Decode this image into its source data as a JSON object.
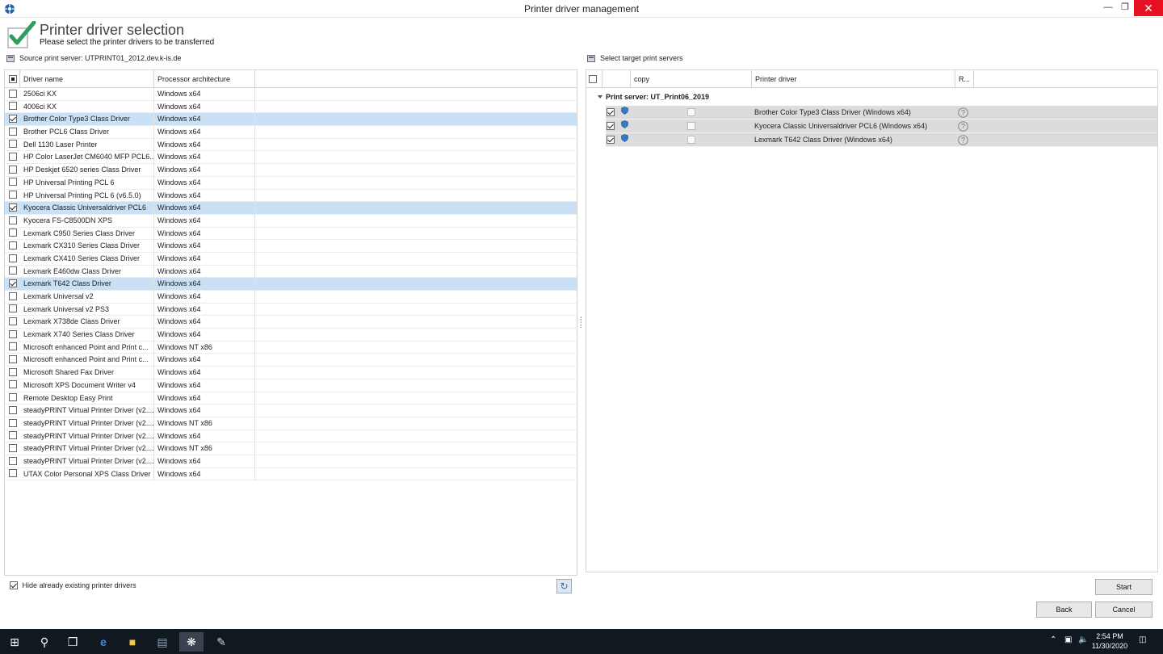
{
  "window": {
    "title": "Printer driver management"
  },
  "header": {
    "title": "Printer driver selection",
    "subtitle": "Please select the printer drivers to be transferred"
  },
  "source": {
    "label": "Source print server: UTPRINT01_2012.dev.k-is.de",
    "columns": [
      "Driver name",
      "Processor architecture"
    ],
    "rows": [
      {
        "name": "2506ci KX",
        "arch": "Windows x64",
        "checked": false
      },
      {
        "name": "4006ci KX",
        "arch": "Windows x64",
        "checked": false
      },
      {
        "name": "Brother Color Type3 Class Driver",
        "arch": "Windows x64",
        "checked": true
      },
      {
        "name": "Brother PCL6 Class Driver",
        "arch": "Windows x64",
        "checked": false
      },
      {
        "name": "Dell 1130 Laser Printer",
        "arch": "Windows x64",
        "checked": false
      },
      {
        "name": "HP Color LaserJet CM6040 MFP PCL6...",
        "arch": "Windows x64",
        "checked": false
      },
      {
        "name": "HP Deskjet 6520 series Class Driver",
        "arch": "Windows x64",
        "checked": false
      },
      {
        "name": "HP Universal Printing PCL 6",
        "arch": "Windows x64",
        "checked": false
      },
      {
        "name": "HP Universal Printing PCL 6 (v6.5.0)",
        "arch": "Windows x64",
        "checked": false
      },
      {
        "name": "Kyocera Classic Universaldriver PCL6",
        "arch": "Windows x64",
        "checked": true
      },
      {
        "name": "Kyocera FS-C8500DN XPS",
        "arch": "Windows x64",
        "checked": false
      },
      {
        "name": "Lexmark C950 Series Class Driver",
        "arch": "Windows x64",
        "checked": false
      },
      {
        "name": "Lexmark CX310 Series Class Driver",
        "arch": "Windows x64",
        "checked": false
      },
      {
        "name": "Lexmark CX410 Series Class Driver",
        "arch": "Windows x64",
        "checked": false
      },
      {
        "name": "Lexmark E460dw Class Driver",
        "arch": "Windows x64",
        "checked": false
      },
      {
        "name": "Lexmark T642 Class Driver",
        "arch": "Windows x64",
        "checked": true
      },
      {
        "name": "Lexmark Universal v2",
        "arch": "Windows x64",
        "checked": false
      },
      {
        "name": "Lexmark Universal v2 PS3",
        "arch": "Windows x64",
        "checked": false
      },
      {
        "name": "Lexmark X738de Class Driver",
        "arch": "Windows x64",
        "checked": false
      },
      {
        "name": "Lexmark X740 Series Class Driver",
        "arch": "Windows x64",
        "checked": false
      },
      {
        "name": "Microsoft enhanced Point and Print c...",
        "arch": "Windows NT x86",
        "checked": false
      },
      {
        "name": "Microsoft enhanced Point and Print c...",
        "arch": "Windows x64",
        "checked": false
      },
      {
        "name": "Microsoft Shared Fax Driver",
        "arch": "Windows x64",
        "checked": false
      },
      {
        "name": "Microsoft XPS Document Writer v4",
        "arch": "Windows x64",
        "checked": false
      },
      {
        "name": "Remote Desktop Easy Print",
        "arch": "Windows x64",
        "checked": false
      },
      {
        "name": "steadyPRINT Virtual Printer Driver (v2....",
        "arch": "Windows x64",
        "checked": false
      },
      {
        "name": "steadyPRINT Virtual Printer Driver (v2....",
        "arch": "Windows NT x86",
        "checked": false
      },
      {
        "name": "steadyPRINT Virtual Printer Driver (v2....",
        "arch": "Windows x64",
        "checked": false
      },
      {
        "name": "steadyPRINT Virtual Printer Driver (v2....",
        "arch": "Windows NT x86",
        "checked": false
      },
      {
        "name": "steadyPRINT Virtual Printer Driver (v2....",
        "arch": "Windows x64",
        "checked": false
      },
      {
        "name": "UTAX Color Personal XPS Class Driver",
        "arch": "Windows x64",
        "checked": false
      }
    ],
    "hide_existing_label": "Hide already existing printer drivers"
  },
  "target": {
    "label": "Select target print servers",
    "columns": {
      "copy": "copy",
      "driver": "Printer driver",
      "r": "R..."
    },
    "group": "Print server: UT_Print06_2019",
    "rows": [
      {
        "driver": "Brother Color Type3 Class Driver (Windows x64)"
      },
      {
        "driver": "Kyocera Classic Universaldriver PCL6 (Windows x64)"
      },
      {
        "driver": "Lexmark T642 Class Driver (Windows x64)"
      }
    ]
  },
  "buttons": {
    "start": "Start",
    "back": "Back",
    "cancel": "Cancel"
  },
  "taskbar": {
    "time": "2:54 PM",
    "date": "11/30/2020"
  },
  "colors": {
    "selected_row": "#c9e0f5",
    "check_green": "#2e9e5e",
    "close_red": "#e81123"
  }
}
